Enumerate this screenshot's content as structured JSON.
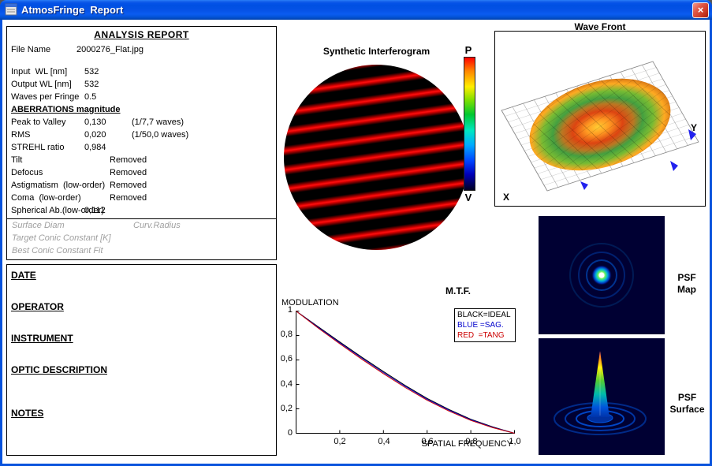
{
  "window": {
    "title": "AtmosFringe  Report",
    "close_label": "×"
  },
  "report": {
    "title": "ANALYSIS  REPORT",
    "aberrations_header": "ABERRATIONS magnitude",
    "rows": [
      {
        "label": "File Name",
        "value": "2000276_Flat.jpg"
      },
      {
        "label": "Input  WL [nm]",
        "value": "532"
      },
      {
        "label": "Output WL [nm]",
        "value": "532"
      },
      {
        "label": "Waves per Fringe",
        "value": "0.5"
      },
      {
        "label": "Peak to Valley",
        "value": "0,130",
        "extra": "(1/7,7 waves)"
      },
      {
        "label": "RMS",
        "value": "0,020",
        "extra": "(1/50,0 waves)"
      },
      {
        "label": "STREHL ratio",
        "value": "0,984"
      },
      {
        "label": "Tilt",
        "value": "Removed"
      },
      {
        "label": "Defocus",
        "value": "Removed"
      },
      {
        "label": "Astigmatism  (low-order)",
        "value": "Removed"
      },
      {
        "label": "Coma  (low-order)",
        "value": "Removed"
      },
      {
        "label": "Spherical Ab.(low-order)",
        "value": "0,112"
      }
    ],
    "disabled": {
      "surface_diam": "Surface Diam",
      "curv_radius": "Curv.Radius",
      "target_conic": "Target Conic Constant [K]",
      "best_conic": "Best Conic Constant Fit"
    }
  },
  "fields": {
    "items": [
      {
        "label": "DATE"
      },
      {
        "label": "OPERATOR"
      },
      {
        "label": "INSTRUMENT"
      },
      {
        "label": "OPTIC DESCRIPTION"
      },
      {
        "label": "NOTES"
      }
    ]
  },
  "interferogram": {
    "title": "Synthetic Interferogram"
  },
  "colorbar": {
    "top_label": "P",
    "bottom_label": "V"
  },
  "wavefront": {
    "title": "Wave Front",
    "x_label": "X",
    "y_label": "Y"
  },
  "psf_map": {
    "line1": "PSF",
    "line2": "Map"
  },
  "psf_surface": {
    "line1": "PSF",
    "line2": "Surface"
  },
  "mtf": {
    "title": "M.T.F.",
    "ylabel": "MODULATION",
    "xlabel": "SPATIAL FREQUENCY",
    "yticks": [
      "1",
      "0,8",
      "0,6",
      "0,4",
      "0,2",
      "0"
    ],
    "xticks": [
      "0,2",
      "0,4",
      "0,6",
      "0,8",
      "1,0"
    ],
    "legend": [
      {
        "text": "BLACK=IDEAL",
        "color": "#000000"
      },
      {
        "text": "BLUE =SAG.",
        "color": "#0000cc"
      },
      {
        "text": "RED  =TANG",
        "color": "#cc0000"
      }
    ]
  },
  "chart_data": {
    "type": "line",
    "title": "M.T.F.",
    "xlabel": "SPATIAL FREQUENCY",
    "ylabel": "MODULATION",
    "xlim": [
      0,
      1
    ],
    "ylim": [
      0,
      1
    ],
    "grid": false,
    "legend_position": "top-right",
    "x": [
      0,
      0.1,
      0.2,
      0.3,
      0.4,
      0.5,
      0.6,
      0.7,
      0.8,
      0.9,
      1.0
    ],
    "series": [
      {
        "name": "IDEAL",
        "color": "#000000",
        "values": [
          1.0,
          0.873,
          0.747,
          0.624,
          0.505,
          0.391,
          0.285,
          0.195,
          0.115,
          0.052,
          0.0
        ]
      },
      {
        "name": "SAG",
        "color": "#0000cc",
        "values": [
          1.0,
          0.868,
          0.74,
          0.616,
          0.497,
          0.383,
          0.278,
          0.189,
          0.11,
          0.049,
          0.0
        ]
      },
      {
        "name": "TANG",
        "color": "#cc0000",
        "values": [
          1.0,
          0.862,
          0.732,
          0.607,
          0.488,
          0.374,
          0.27,
          0.182,
          0.105,
          0.046,
          0.0
        ]
      }
    ]
  }
}
